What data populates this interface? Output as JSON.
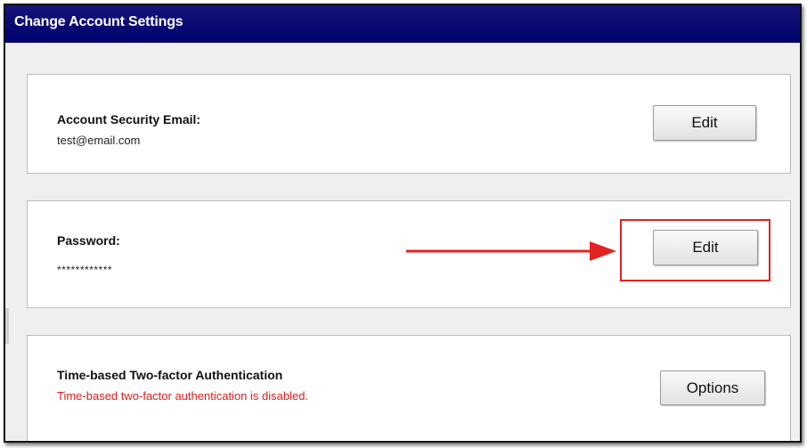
{
  "window": {
    "title": "Change Account Settings"
  },
  "email_section": {
    "label": "Account Security Email:",
    "value": "test@email.com",
    "edit_label": "Edit"
  },
  "password_section": {
    "label": "Password:",
    "value": "************",
    "edit_label": "Edit"
  },
  "twofa_section": {
    "label": "Time-based Two-factor Authentication",
    "status": "Time-based two-factor authentication is disabled.",
    "options_label": "Options"
  },
  "colors": {
    "titlebar": "#00006e",
    "highlight": "#e32222",
    "status_error": "#e21c1c"
  },
  "annotations": {
    "arrow_icon": "right-arrow-icon",
    "highlight_box": "red-rectangle"
  }
}
